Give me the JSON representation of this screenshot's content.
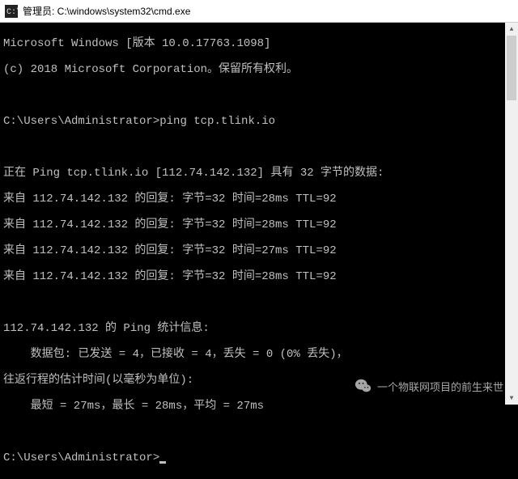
{
  "window": {
    "title": "管理员: C:\\windows\\system32\\cmd.exe"
  },
  "terminal": {
    "header1": "Microsoft Windows [版本 10.0.17763.1098]",
    "header2": "(c) 2018 Microsoft Corporation。保留所有权利。",
    "prompt1": "C:\\Users\\Administrator>",
    "command1": "ping tcp.tlink.io",
    "ping_start": "正在 Ping tcp.tlink.io [112.74.142.132] 具有 32 字节的数据:",
    "reply1": "来自 112.74.142.132 的回复: 字节=32 时间=28ms TTL=92",
    "reply2": "来自 112.74.142.132 的回复: 字节=32 时间=28ms TTL=92",
    "reply3": "来自 112.74.142.132 的回复: 字节=32 时间=27ms TTL=92",
    "reply4": "来自 112.74.142.132 的回复: 字节=32 时间=28ms TTL=92",
    "stats_header": "112.74.142.132 的 Ping 统计信息:",
    "stats_packets": "    数据包: 已发送 = 4，已接收 = 4，丢失 = 0 (0% 丢失)，",
    "stats_rtt_header": "往返行程的估计时间(以毫秒为单位):",
    "stats_rtt": "    最短 = 27ms，最长 = 28ms，平均 = 27ms",
    "prompt2": "C:\\Users\\Administrator>"
  },
  "watermark": {
    "text": "一个物联网项目的前生来世"
  }
}
